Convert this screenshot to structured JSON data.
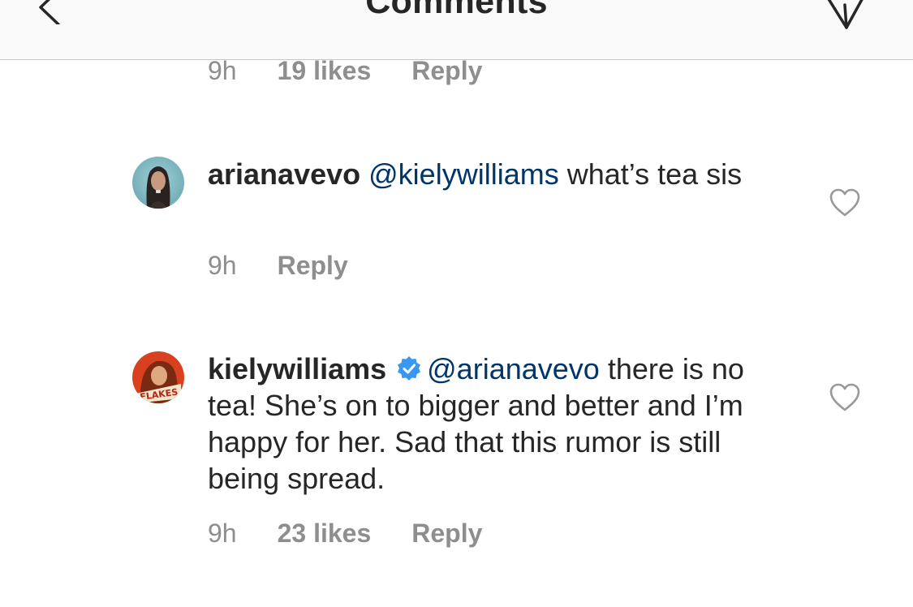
{
  "header": {
    "title": "Comments"
  },
  "top_meta": {
    "time": "9h",
    "likes": "19 likes",
    "reply": "Reply"
  },
  "comments": [
    {
      "username": "arianavevo",
      "mention": "@kielywilliams",
      "text": " what’s tea sis",
      "time": "9h",
      "reply": "Reply"
    },
    {
      "username": "kielywilliams",
      "verified": true,
      "mention": "@arianavevo",
      "text": " there is no tea! She’s on to bigger and better and I’m happy for her. Sad that this rumor is still being spread.",
      "time": "9h",
      "likes": "23 likes",
      "reply": "Reply"
    }
  ],
  "colors": {
    "text": "#262626",
    "meta": "#8e8e8e",
    "mention": "#003569",
    "verified": "#3897f0",
    "header_bg": "#f9f9f9"
  },
  "icons": {
    "back": "chevron-left-icon",
    "send": "paper-plane-icon",
    "like": "heart-icon",
    "verified": "verified-badge-icon"
  }
}
